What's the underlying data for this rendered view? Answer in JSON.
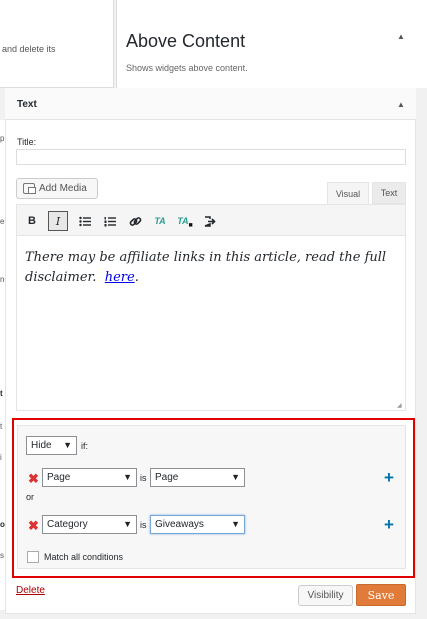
{
  "background_left": {
    "top_text": "and delete its",
    "fragments": [
      "p",
      "e",
      "ne",
      "t",
      "t",
      "i",
      "o",
      "s"
    ]
  },
  "sidebar": {
    "title": "Above Content",
    "description": "Shows widgets above content."
  },
  "widget": {
    "title": "Text",
    "title_field_label": "Title:",
    "title_field_value": "",
    "add_media_label": "Add Media",
    "tabs": {
      "visual": "Visual",
      "text": "Text"
    },
    "toolbar": [
      "bold",
      "italic",
      "bulleted-list",
      "numbered-list",
      "link",
      "ta",
      "ta-lock",
      "exit-fullscreen"
    ],
    "toolbar_labels": {
      "bold": "B",
      "italic": "I",
      "ta": "TA",
      "ta_lock": "TA"
    },
    "content_text": "There may be affiliate links in this article, read the full disclaimer.",
    "content_link": "here",
    "content_suffix": "."
  },
  "visibility": {
    "action": "Hide",
    "if_label": "if:",
    "rule1": {
      "major": "Page",
      "is_label": "is",
      "minor": "Page"
    },
    "or_label": "or",
    "rule2": {
      "major": "Category",
      "is_label": "is",
      "minor": "Giveaways"
    },
    "match_all_label": "Match all conditions",
    "match_all_checked": false
  },
  "footer": {
    "delete_label": "Delete",
    "visibility_button": "Visibility",
    "save_button": "Save"
  },
  "colors": {
    "highlight_border": "#e00000",
    "remove_icon": "#dc3232",
    "add_icon": "#0073aa",
    "save_button": "#e07b39"
  }
}
